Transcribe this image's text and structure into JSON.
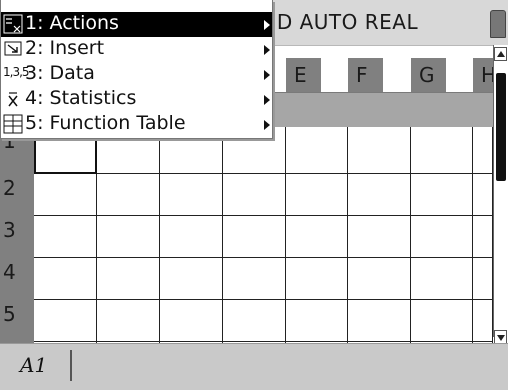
{
  "status_bar": {
    "text": ".D AUTO REAL",
    "battery_icon": "battery-icon"
  },
  "menu": {
    "items": [
      {
        "label": "1: Actions",
        "icon": "actions-icon",
        "active": true
      },
      {
        "label": "2: Insert",
        "icon": "insert-icon"
      },
      {
        "label": "3: Data",
        "icon": "data-icon"
      },
      {
        "label": "4: Statistics",
        "icon": "statistics-icon"
      },
      {
        "label": "5: Function Table",
        "icon": "function-table-icon"
      }
    ],
    "data_icon_text": "1,3,5"
  },
  "columns": [
    "E",
    "F",
    "G",
    "H"
  ],
  "rows": [
    "1",
    "2",
    "3",
    "4",
    "5"
  ],
  "cell_reference": "A1"
}
